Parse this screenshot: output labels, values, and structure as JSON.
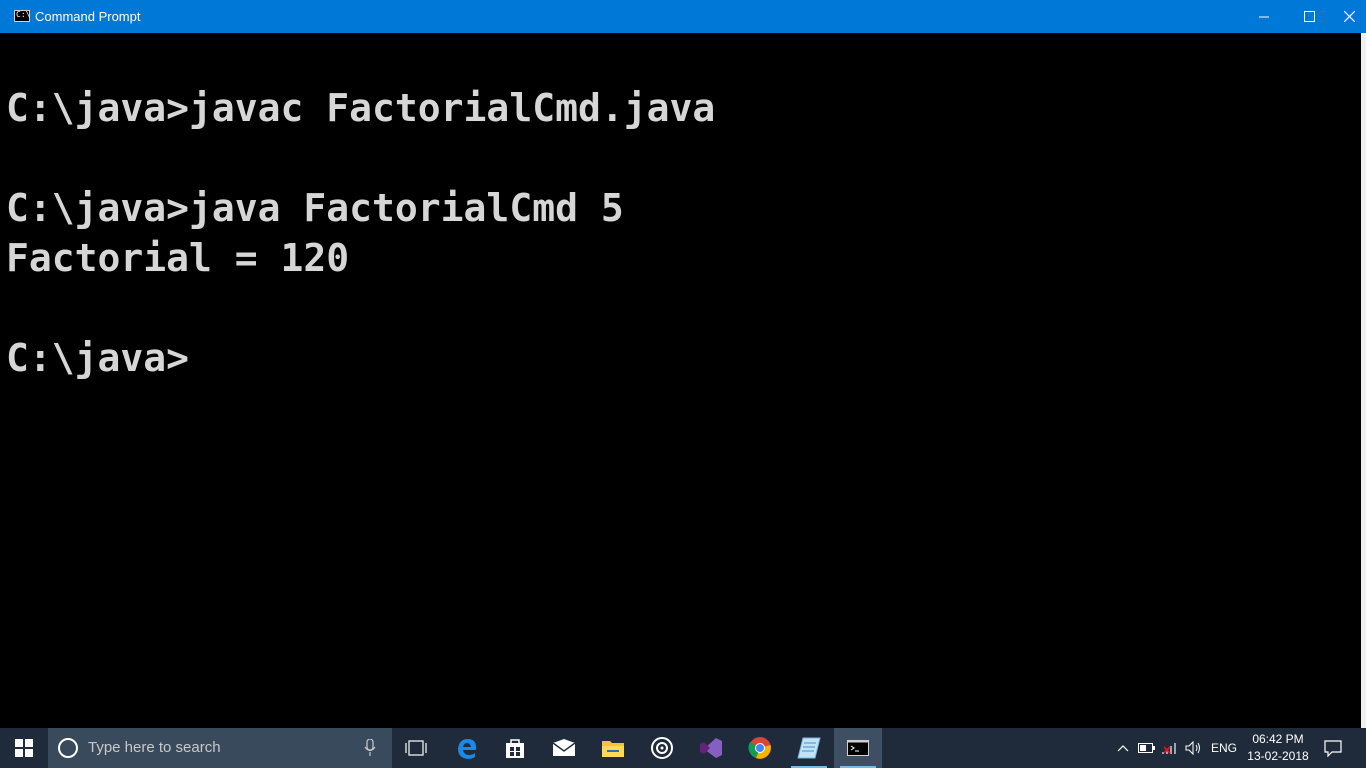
{
  "window": {
    "title": "Command Prompt",
    "icon_glyph": "C:\\"
  },
  "console": {
    "lines": [
      "C:\\java>javac FactorialCmd.java",
      "C:\\java>java FactorialCmd 5",
      "Factorial = 120",
      "C:\\java>"
    ]
  },
  "taskbar": {
    "search_placeholder": "Type here to search",
    "language": "ENG",
    "time": "06:42 PM",
    "date": "13-02-2018"
  },
  "colors": {
    "titlebar": "#0078d7",
    "console_bg": "#000000",
    "console_text": "#d6d6d6",
    "taskbar": "#1f2b3b"
  },
  "icons": [
    "cmd-icon",
    "minimize-icon",
    "maximize-icon",
    "close-icon",
    "windows-start-icon",
    "cortana-icon",
    "microphone-icon",
    "task-view-icon",
    "edge-icon",
    "store-icon",
    "mail-icon",
    "file-explorer-icon",
    "groove-music-icon",
    "visual-studio-icon",
    "chrome-icon",
    "notepad-icon",
    "cmd-icon",
    "chevron-up-icon",
    "battery-icon",
    "network-icon",
    "volume-icon",
    "notification-icon"
  ]
}
